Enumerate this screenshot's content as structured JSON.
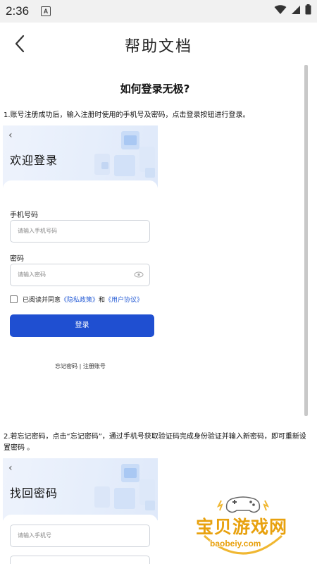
{
  "status_bar": {
    "time": "2:36",
    "notification_icon": "A"
  },
  "header": {
    "title": "帮助文档",
    "back_icon": "chevron-left-icon"
  },
  "doc": {
    "heading": "如何登录无极?",
    "step1": "1.账号注册成功后，输入注册时使用的手机号及密码，点击登录按钮进行登录。",
    "step2": "2.若忘记密码，点击“忘记密码”，通过手机号获取验证码完成身份验证并输入新密码，即可重新设置密码 。"
  },
  "login_card": {
    "title": "欢迎登录",
    "phone_label": "手机号码",
    "phone_placeholder": "请输入手机号码",
    "password_label": "密码",
    "password_placeholder": "请输入密码",
    "agree_prefix": "已阅读并同意",
    "privacy_link": "《隐私政策》",
    "and_text": "和",
    "terms_link": "《用户协议》",
    "login_button": "登录",
    "forgot_link": "忘记密码",
    "separator": "|",
    "register_link": "注册账号"
  },
  "reset_card": {
    "title": "找回密码",
    "phone_placeholder": "请输入手机号"
  },
  "watermark": {
    "text": "宝贝游戏网",
    "url": "baobeiy.com"
  }
}
